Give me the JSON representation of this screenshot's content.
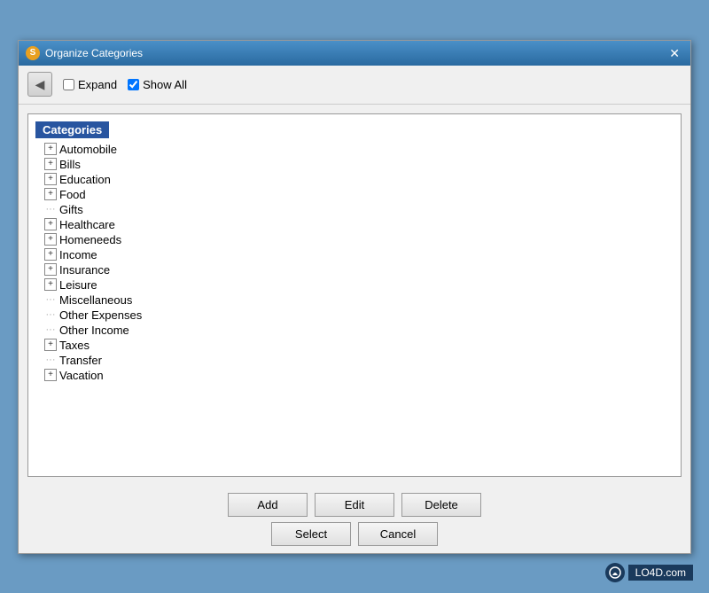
{
  "window": {
    "title": "Organize Categories",
    "icon": "S",
    "close_label": "✕"
  },
  "toolbar": {
    "back_label": "◀",
    "expand_label": "Expand",
    "show_all_label": "Show All",
    "expand_checked": false,
    "show_all_checked": true
  },
  "tree": {
    "header": "Categories",
    "items": [
      {
        "label": "Automobile",
        "type": "expandable",
        "indent": 0
      },
      {
        "label": "Bills",
        "type": "expandable",
        "indent": 0
      },
      {
        "label": "Education",
        "type": "expandable",
        "indent": 0
      },
      {
        "label": "Food",
        "type": "expandable",
        "indent": 0
      },
      {
        "label": "Gifts",
        "type": "leaf",
        "indent": 0
      },
      {
        "label": "Healthcare",
        "type": "expandable",
        "indent": 0
      },
      {
        "label": "Homeneeds",
        "type": "expandable",
        "indent": 0
      },
      {
        "label": "Income",
        "type": "expandable",
        "indent": 0
      },
      {
        "label": "Insurance",
        "type": "expandable",
        "indent": 0
      },
      {
        "label": "Leisure",
        "type": "expandable",
        "indent": 0
      },
      {
        "label": "Miscellaneous",
        "type": "dotted",
        "indent": 0
      },
      {
        "label": "Other Expenses",
        "type": "dotted",
        "indent": 0
      },
      {
        "label": "Other Income",
        "type": "dotted",
        "indent": 0
      },
      {
        "label": "Taxes",
        "type": "expandable",
        "indent": 0
      },
      {
        "label": "Transfer",
        "type": "dotted",
        "indent": 0
      },
      {
        "label": "Vacation",
        "type": "expandable",
        "indent": 0
      }
    ]
  },
  "buttons": {
    "add": "Add",
    "edit": "Edit",
    "delete": "Delete",
    "select": "Select",
    "cancel": "Cancel"
  },
  "watermark": "LO4D.com"
}
